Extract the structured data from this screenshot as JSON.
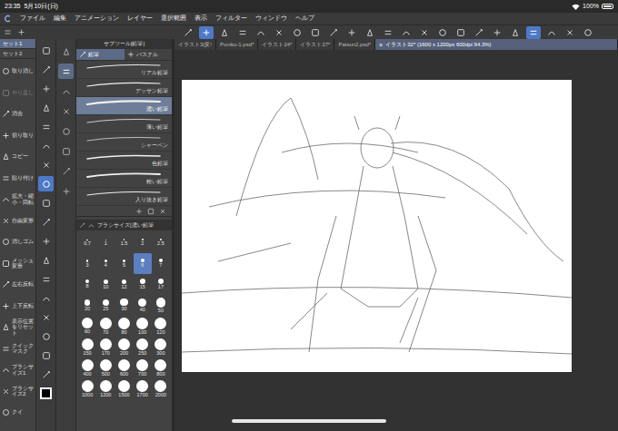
{
  "status_bar": {
    "time": "23:35",
    "date": "5月10日(日)",
    "battery": "100%"
  },
  "menu": [
    "ファイル",
    "編集",
    "アニメーション",
    "レイヤー",
    "選択範囲",
    "表示",
    "フィルター",
    "ウィンドウ",
    "ヘルプ"
  ],
  "command_bar": [
    {
      "selected": false
    },
    {
      "selected": true
    },
    {
      "selected": false
    },
    {
      "selected": false
    },
    {
      "selected": false
    },
    {
      "selected": false
    },
    {
      "selected": false
    },
    {
      "selected": false
    },
    {
      "selected": false
    },
    {
      "selected": false
    },
    {
      "selected": false
    },
    {
      "selected": false
    },
    {
      "selected": false
    },
    {
      "selected": false
    },
    {
      "selected": false
    },
    {
      "selected": false
    },
    {
      "selected": false
    },
    {
      "selected": false
    },
    {
      "selected": false
    },
    {
      "selected": true
    },
    {
      "selected": false
    },
    {
      "selected": false
    },
    {
      "selected": false
    }
  ],
  "tab_close": "×",
  "doc_tabs": [
    {
      "label": "イラスト3(変!",
      "selected": false
    },
    {
      "label": "Poniko-1.psd*",
      "selected": false
    },
    {
      "label": "イラスト24*",
      "selected": false
    },
    {
      "label": "イラスト27*",
      "selected": false
    },
    {
      "label": "Patsun2.psd*",
      "selected": false
    },
    {
      "label": "イラスト32* (1600 x 1200px 600dpi 94.3%)",
      "selected": true
    }
  ],
  "command_sets": [
    {
      "label": "セット1",
      "selected": true
    },
    {
      "label": "セット2",
      "selected": false
    }
  ],
  "commands": [
    {
      "label": "取り消し",
      "disabled": false
    },
    {
      "label": "やり直し",
      "disabled": true
    },
    {
      "label": "消去",
      "disabled": false
    },
    {
      "label": "切り取り",
      "disabled": false
    },
    {
      "label": "コピー",
      "disabled": false
    },
    {
      "label": "貼り付け",
      "disabled": false
    },
    {
      "label": "拡大・縮小・回転",
      "disabled": false
    },
    {
      "label": "自由変形",
      "disabled": false
    },
    {
      "label": "消しゴム",
      "disabled": false
    },
    {
      "label": "メッシュ変形",
      "disabled": false
    },
    {
      "label": "左右反転",
      "disabled": false
    },
    {
      "label": "上下反転",
      "disabled": false
    },
    {
      "label": "表示位置をリセット",
      "disabled": false
    },
    {
      "label": "クイックマスク",
      "disabled": false
    },
    {
      "label": "ブラシサイズ1",
      "disabled": false
    },
    {
      "label": "ブラシサイズ2",
      "disabled": false
    },
    {
      "label": "クイ",
      "disabled": false
    }
  ],
  "tools": [
    {
      "selected": false
    },
    {
      "selected": false
    },
    {
      "selected": false
    },
    {
      "selected": false
    },
    {
      "selected": false
    },
    {
      "selected": false
    },
    {
      "selected": false
    },
    {
      "selected": true
    },
    {
      "selected": false
    },
    {
      "selected": false
    },
    {
      "selected": false
    },
    {
      "selected": false
    },
    {
      "selected": false
    },
    {
      "selected": false
    },
    {
      "selected": false
    },
    {
      "selected": false
    },
    {
      "selected": false
    },
    {
      "selected": false
    }
  ],
  "tool_groups": [
    {
      "selected": false
    },
    {
      "selected": true
    },
    {
      "selected": false
    },
    {
      "selected": false
    },
    {
      "selected": false
    },
    {
      "selected": false
    },
    {
      "selected": false
    },
    {
      "selected": false
    }
  ],
  "subtool": {
    "title": "サブツール[鉛筆]",
    "groups": [
      {
        "label": "鉛筆",
        "selected": true
      },
      {
        "label": "パステル",
        "selected": false
      }
    ],
    "items": [
      {
        "label": "リアル鉛筆",
        "selected": false
      },
      {
        "label": "デッサン鉛筆",
        "selected": false
      },
      {
        "label": "濃い鉛筆",
        "selected": true
      },
      {
        "label": "薄い鉛筆",
        "selected": false
      },
      {
        "label": "シャーペン",
        "selected": false
      },
      {
        "label": "色鉛筆",
        "selected": false
      },
      {
        "label": "粗い鉛筆",
        "selected": false
      },
      {
        "label": "入り抜き鉛筆",
        "selected": false
      }
    ]
  },
  "brush_size": {
    "title": "ブラシサイズ[濃い鉛筆",
    "sizes": [
      {
        "label": "0.7",
        "selected": false
      },
      {
        "label": "1",
        "selected": false
      },
      {
        "label": "1.5",
        "selected": false
      },
      {
        "label": "2",
        "selected": false
      },
      {
        "label": "2.5",
        "selected": false
      },
      {
        "label": "3",
        "selected": false
      },
      {
        "label": "4",
        "selected": false
      },
      {
        "label": "5",
        "selected": false
      },
      {
        "label": "6",
        "selected": true
      },
      {
        "label": "7",
        "selected": false
      },
      {
        "label": "8",
        "selected": false
      },
      {
        "label": "10",
        "selected": false
      },
      {
        "label": "12",
        "selected": false
      },
      {
        "label": "15",
        "selected": false
      },
      {
        "label": "17",
        "selected": false
      },
      {
        "label": "20",
        "selected": false
      },
      {
        "label": "25",
        "selected": false
      },
      {
        "label": "30",
        "selected": false
      },
      {
        "label": "40",
        "selected": false
      },
      {
        "label": "50",
        "selected": false
      },
      {
        "label": "60",
        "selected": false
      },
      {
        "label": "70",
        "selected": false
      },
      {
        "label": "80",
        "selected": false
      },
      {
        "label": "100",
        "selected": false
      },
      {
        "label": "120",
        "selected": false
      },
      {
        "label": "150",
        "selected": false
      },
      {
        "label": "170",
        "selected": false
      },
      {
        "label": "200",
        "selected": false
      },
      {
        "label": "250",
        "selected": false
      },
      {
        "label": "300",
        "selected": false
      },
      {
        "label": "400",
        "selected": false
      },
      {
        "label": "500",
        "selected": false
      },
      {
        "label": "600",
        "selected": false
      },
      {
        "label": "700",
        "selected": false
      },
      {
        "label": "800",
        "selected": false
      },
      {
        "label": "1000",
        "selected": false
      },
      {
        "label": "1200",
        "selected": false
      },
      {
        "label": "1500",
        "selected": false
      },
      {
        "label": "1700",
        "selected": false
      },
      {
        "label": "2000",
        "selected": false
      }
    ]
  }
}
